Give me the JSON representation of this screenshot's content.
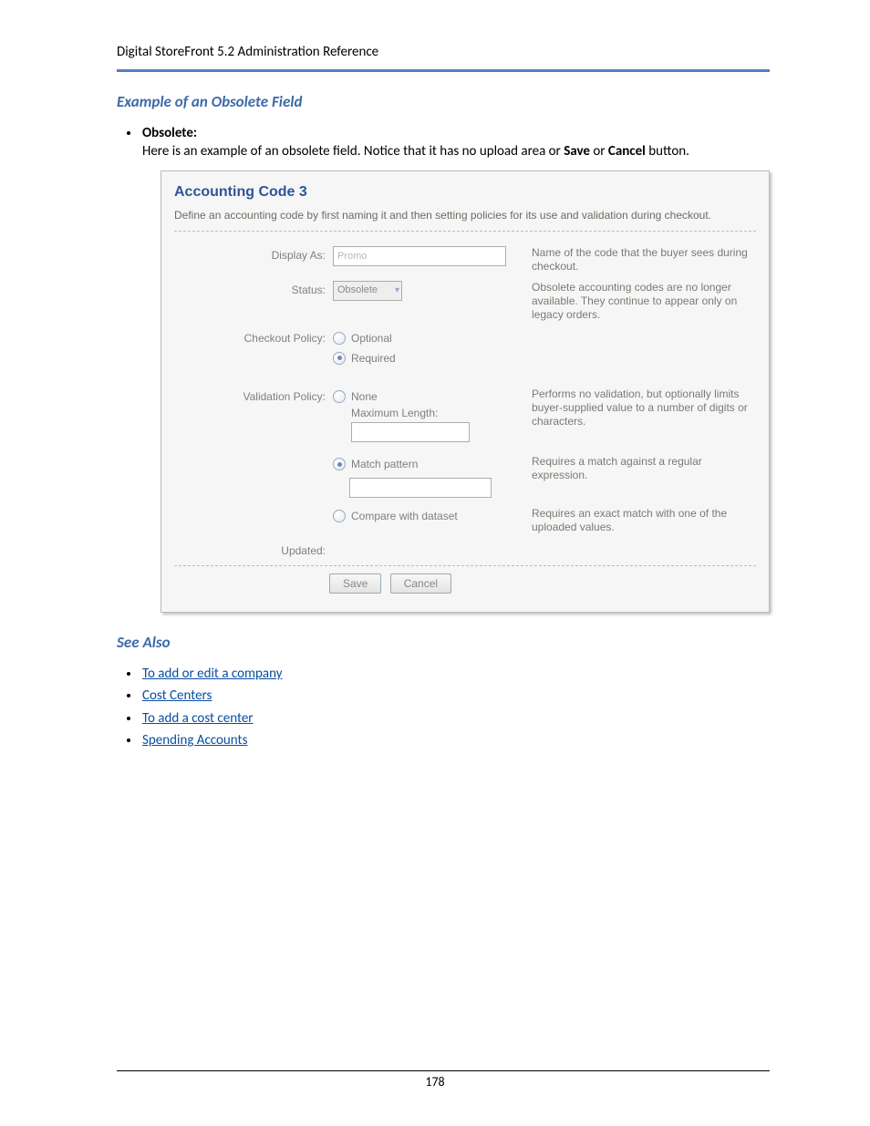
{
  "header": "Digital StoreFront 5.2 Administration Reference",
  "section": {
    "title": "Example of an Obsolete Field",
    "obsolete_label": "Obsolete:",
    "obsolete_text_prefix": "Here is an example of an obsolete field. Notice that it has no upload area or ",
    "obsolete_text_save": "Save",
    "obsolete_text_or": " or ",
    "obsolete_text_cancel": "Cancel",
    "obsolete_text_suffix": " button."
  },
  "panel": {
    "title": "Accounting Code 3",
    "description": "Define an accounting code by first naming it and then setting policies for its use and validation during checkout.",
    "display_as": {
      "label": "Display As:",
      "value": "Promo",
      "help": "Name of the code that the buyer sees during checkout."
    },
    "status": {
      "label": "Status:",
      "value": "Obsolete",
      "help": "Obsolete accounting codes are no longer available. They continue to appear only on legacy orders."
    },
    "checkout_policy": {
      "label": "Checkout Policy:",
      "options": {
        "optional": "Optional",
        "required": "Required"
      },
      "selected": "required"
    },
    "validation_policy": {
      "label": "Validation Policy:",
      "none": {
        "label": "None",
        "sublabel": "Maximum Length:",
        "help": "Performs no validation, but optionally limits buyer-supplied value to a number of digits or characters."
      },
      "match": {
        "label": "Match pattern",
        "help": "Requires a match against a regular expression."
      },
      "compare": {
        "label": "Compare with dataset",
        "help": "Requires an exact match with one of the uploaded values."
      },
      "selected": "match"
    },
    "updated_label": "Updated:",
    "buttons": {
      "save": "Save",
      "cancel": "Cancel"
    }
  },
  "see_also": {
    "title": "See Also",
    "links": [
      "To add or edit a company",
      "Cost Centers",
      "To add a cost center",
      "Spending Accounts"
    ]
  },
  "page_number": "178"
}
